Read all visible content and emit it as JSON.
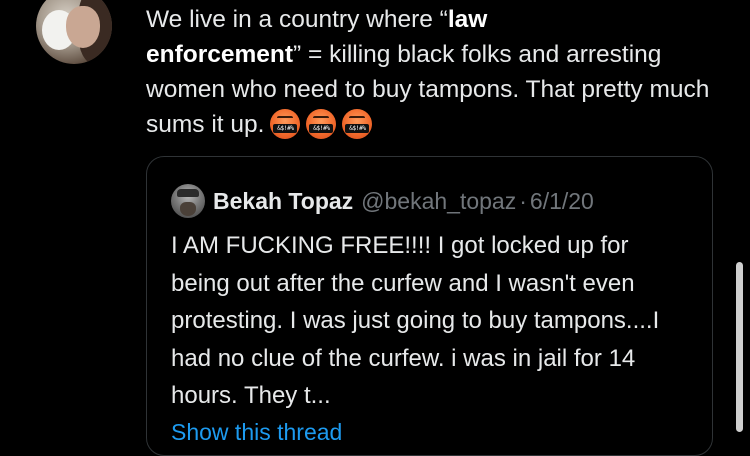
{
  "tweet": {
    "text_part1": "We live in a country where “",
    "bold_1": "law",
    "bold_2": "enforcement",
    "text_part2": "” = killing black folks and arresting women who need to buy tampons. That pretty much sums it up.",
    "emojis": [
      {
        "icon": "face-with-symbols-on-mouth-icon",
        "symbol_text": "&$!#%"
      },
      {
        "icon": "face-with-symbols-on-mouth-icon",
        "symbol_text": "&$!#%"
      },
      {
        "icon": "face-with-symbols-on-mouth-icon",
        "symbol_text": "&$!#%"
      }
    ]
  },
  "quoted_tweet": {
    "author_name": "Bekah Topaz",
    "author_handle": "@bekah_topaz",
    "separator": "·",
    "date": "6/1/20",
    "body": "I AM FUCKING FREE!!!! I got locked up for being out after the curfew and I wasn't even protesting. I was just going to buy tampons....I had no clue of the curfew. i was in jail for 14 hours. They t...",
    "show_thread_label": "Show this thread"
  },
  "colors": {
    "background": "#000000",
    "text": "#e7e9ea",
    "muted": "#71767b",
    "link": "#1d9bf0",
    "border": "#2f3336"
  }
}
